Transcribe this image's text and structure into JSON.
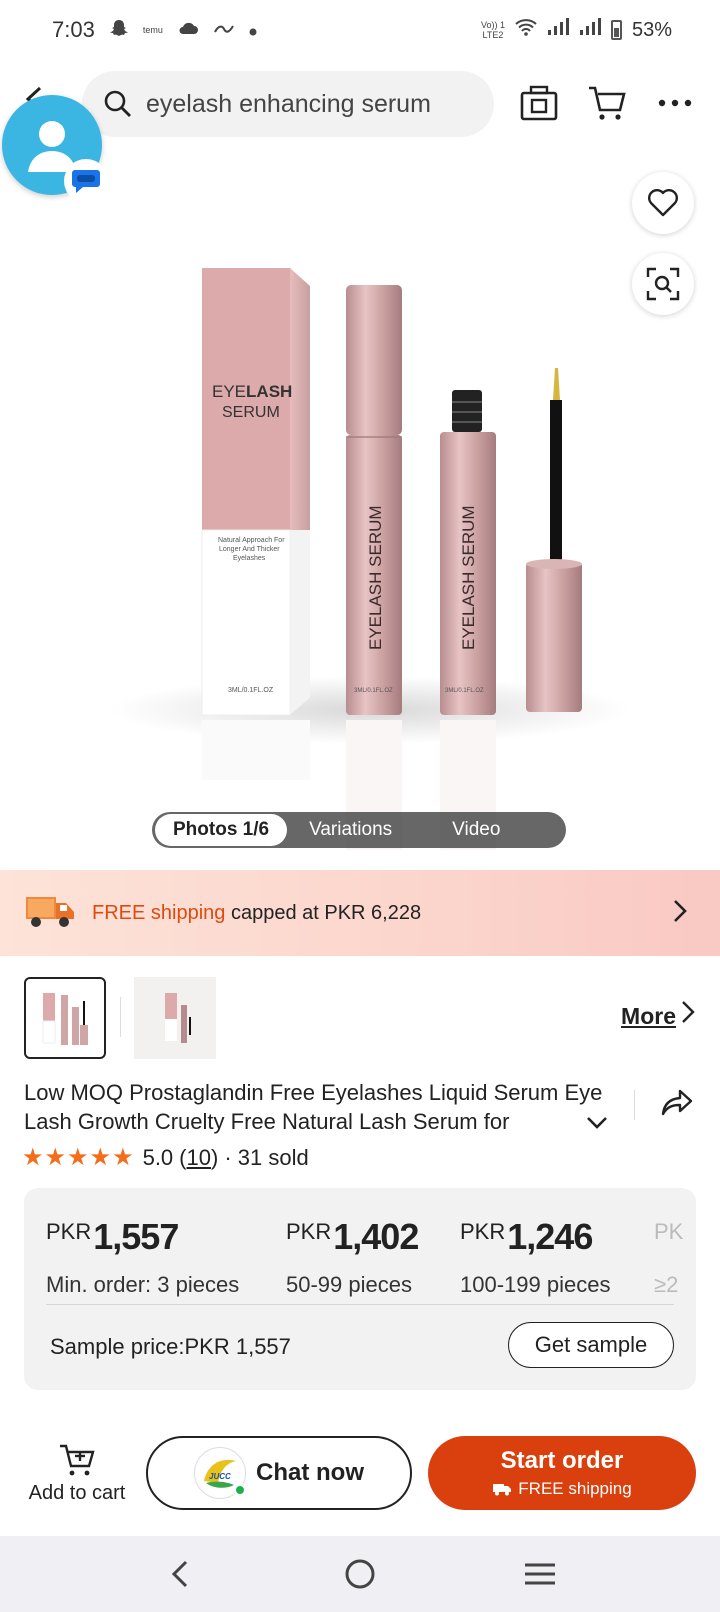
{
  "status_bar": {
    "time": "7:03",
    "left_icons": [
      "snapchat-icon",
      "temu-icon",
      "cloud-icon",
      "link-icon",
      "dot-icon"
    ],
    "temu_label": "temu",
    "network_label_top": "Vo)) 1",
    "network_label_bottom": "LTE2",
    "battery_percent": "53%",
    "battery_level": 0.53
  },
  "header": {
    "search_query": "eyelash enhancing serum",
    "icons": [
      "back-arrow-icon",
      "search-icon",
      "camera-icon",
      "cart-icon",
      "more-dots-icon"
    ]
  },
  "product_image": {
    "box_title_light": "EYE",
    "box_title_bold": "LASH",
    "box_title_line2": "SERUM",
    "box_subtitle": "Natural Approach For Longer And Thicker Eyelashes",
    "box_volume": "3ML/0.1FL.OZ",
    "tube_label": "EYELASH SERUM",
    "tube_volume": "3ML/0.1FL.OZ",
    "media_tabs": [
      "Photos 1/6",
      "Variations",
      "Video"
    ],
    "active_media_tab": 0
  },
  "shipping_banner": {
    "free_label": "FREE shipping",
    "cap_text": "capped at PKR 6,228"
  },
  "thumbnails": {
    "count_visible": 2,
    "selected_index": 0,
    "more_label": "More"
  },
  "product": {
    "title": "Low MOQ Prostaglandin Free Eyelashes Liquid Serum Eye Lash Growth Cruelty Free Natural Lash Serum for",
    "rating_value": "5.0",
    "rating_count": "10",
    "stars": 5,
    "sold_text": "· 31 sold"
  },
  "pricing": {
    "tiers": [
      {
        "currency": "PKR",
        "price": "1,557",
        "qty": "Min. order: 3 pieces"
      },
      {
        "currency": "PKR",
        "price": "1,402",
        "qty": "50-99 pieces"
      },
      {
        "currency": "PKR",
        "price": "1,246",
        "qty": "100-199 pieces"
      },
      {
        "currency": "PK",
        "price": "",
        "qty": "≥2"
      }
    ],
    "sample_price_text": "Sample price:PKR 1,557",
    "get_sample_label": "Get sample"
  },
  "actions": {
    "add_to_cart_label": "Add to cart",
    "chat_now_label": "Chat now",
    "chat_logo_text": "JUCC",
    "start_order_label": "Start order",
    "start_order_sub": "FREE shipping"
  },
  "colors": {
    "accent_orange": "#d9400d",
    "free_shipping_orange": "#e04a10",
    "star_orange": "#f46d1b",
    "product_pink": "#d9aeae",
    "contact_blue": "#3bb6e3"
  }
}
